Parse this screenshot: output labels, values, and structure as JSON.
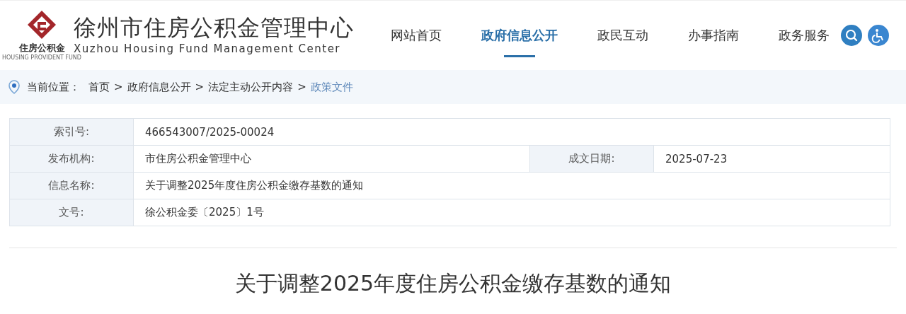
{
  "logo": {
    "title": "徐州市住房公积金管理中心",
    "emblem_text": "住房公积金",
    "emblem_subtext": "HOUSING PROVIDENT FUND",
    "subtitle": "Xuzhou Housing Fund Management Center"
  },
  "nav": [
    {
      "label": "网站首页",
      "selected": false
    },
    {
      "label": "政府信息公开",
      "selected": true
    },
    {
      "label": "政民互动",
      "selected": false
    },
    {
      "label": "办事指南",
      "selected": false
    },
    {
      "label": "政务服务",
      "selected": false
    }
  ],
  "breadcrumb": {
    "label": "当前位置：",
    "separator": ">",
    "items": [
      {
        "label": "首页",
        "selected": false
      },
      {
        "label": "政府信息公开",
        "selected": false
      },
      {
        "label": "法定主动公开内容",
        "selected": false
      },
      {
        "label": "政策文件",
        "selected": true
      }
    ]
  },
  "info_table": [
    [
      {
        "label": "索引号:",
        "value": "466543007/2025-00024"
      }
    ],
    [
      {
        "label": "发布机构:",
        "value": "市住房公积金管理中心"
      },
      {
        "label": "成文日期:",
        "value": "2025-07-23"
      }
    ],
    [
      {
        "label": "信息名称:",
        "value": "关于调整2025年度住房公积金缴存基数的通知"
      }
    ],
    [
      {
        "label": "文号:",
        "value": "徐公积金委〔2025〕1号"
      }
    ]
  ],
  "article": {
    "title": "关于调整2025年度住房公积金缴存基数的通知"
  }
}
